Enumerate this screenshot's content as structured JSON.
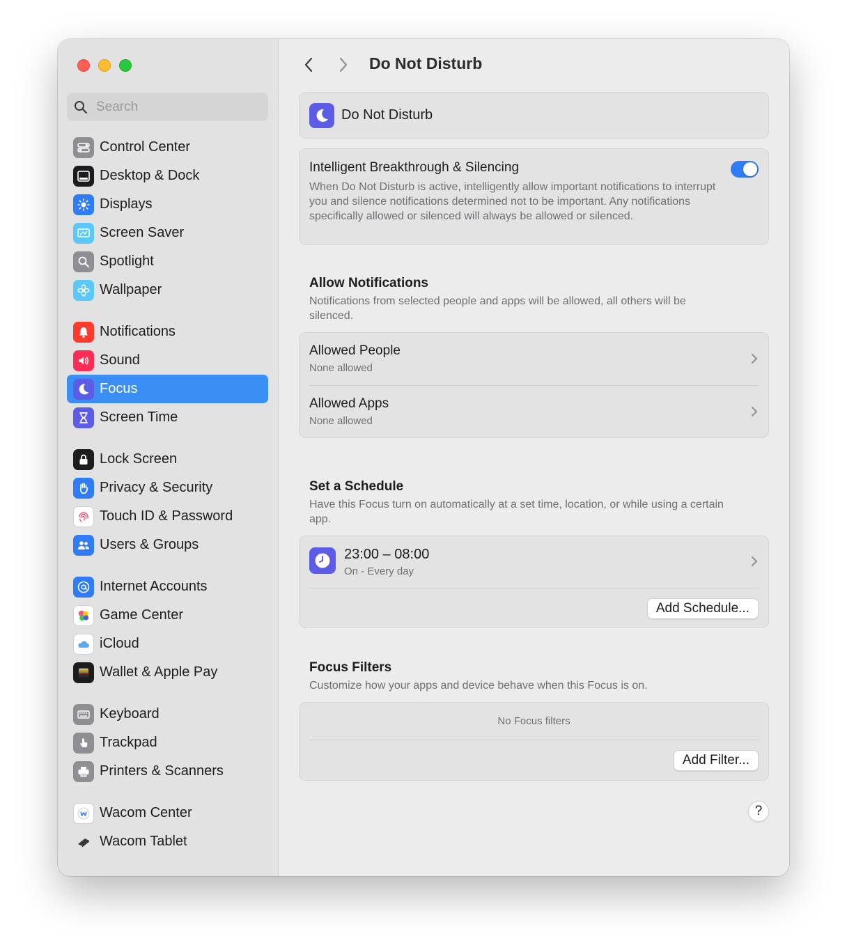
{
  "search": {
    "placeholder": "Search"
  },
  "sidebar": {
    "groups": [
      [
        {
          "label": "Control Center",
          "icon": "control-center-icon",
          "color": "#8e8e93"
        },
        {
          "label": "Desktop & Dock",
          "icon": "desktop-dock-icon",
          "color": "#1c1c1e"
        },
        {
          "label": "Displays",
          "icon": "displays-icon",
          "color": "#2f7cf6"
        },
        {
          "label": "Screen Saver",
          "icon": "screen-saver-icon",
          "color": "#5ac8fa"
        },
        {
          "label": "Spotlight",
          "icon": "spotlight-icon",
          "color": "#8e8e93"
        },
        {
          "label": "Wallpaper",
          "icon": "wallpaper-icon",
          "color": "#5ac8fa"
        }
      ],
      [
        {
          "label": "Notifications",
          "icon": "notifications-icon",
          "color": "#ff3b30"
        },
        {
          "label": "Sound",
          "icon": "sound-icon",
          "color": "#ff2d55"
        },
        {
          "label": "Focus",
          "icon": "focus-icon",
          "color": "#5d5ce6",
          "active": true
        },
        {
          "label": "Screen Time",
          "icon": "screen-time-icon",
          "color": "#5d5ce6"
        }
      ],
      [
        {
          "label": "Lock Screen",
          "icon": "lock-icon",
          "color": "#1c1c1e"
        },
        {
          "label": "Privacy & Security",
          "icon": "hand-icon",
          "color": "#2f7cf6"
        },
        {
          "label": "Touch ID & Password",
          "icon": "fingerprint-icon",
          "color": "#ffffff"
        },
        {
          "label": "Users & Groups",
          "icon": "users-icon",
          "color": "#2f7cf6"
        }
      ],
      [
        {
          "label": "Internet Accounts",
          "icon": "at-icon",
          "color": "#2f7cf6"
        },
        {
          "label": "Game Center",
          "icon": "game-center-icon",
          "color": "#ffffff"
        },
        {
          "label": "iCloud",
          "icon": "cloud-icon",
          "color": "#ffffff"
        },
        {
          "label": "Wallet & Apple Pay",
          "icon": "wallet-icon",
          "color": "#1c1c1e"
        }
      ],
      [
        {
          "label": "Keyboard",
          "icon": "keyboard-icon",
          "color": "#8e8e93"
        },
        {
          "label": "Trackpad",
          "icon": "trackpad-icon",
          "color": "#8e8e93"
        },
        {
          "label": "Printers & Scanners",
          "icon": "printer-icon",
          "color": "#8e8e93"
        }
      ],
      [
        {
          "label": "Wacom Center",
          "icon": "wacom-center-icon",
          "color": "#ffffff"
        },
        {
          "label": "Wacom Tablet",
          "icon": "wacom-tablet-icon",
          "color": "#ffffff"
        }
      ]
    ]
  },
  "header": {
    "title": "Do Not Disturb"
  },
  "dnd": {
    "label": "Do Not Disturb"
  },
  "breakthrough": {
    "title": "Intelligent Breakthrough & Silencing",
    "description": "When Do Not Disturb is active, intelligently allow important notifications to interrupt you and silence notifications determined not to be important. Any notifications specifically allowed or silenced will always be allowed or silenced.",
    "enabled": true
  },
  "allow": {
    "title": "Allow Notifications",
    "description": "Notifications from selected people and apps will be allowed, all others will be silenced.",
    "people": {
      "title": "Allowed People",
      "sub": "None allowed"
    },
    "apps": {
      "title": "Allowed Apps",
      "sub": "None allowed"
    }
  },
  "schedule": {
    "title": "Set a Schedule",
    "description": "Have this Focus turn on automatically at a set time, location, or while using a certain app.",
    "time": "23:00 – 08:00",
    "sub": "On - Every day",
    "add_label": "Add Schedule..."
  },
  "filters": {
    "title": "Focus Filters",
    "description": "Customize how your apps and device behave when this Focus is on.",
    "empty": "No Focus filters",
    "add_label": "Add Filter..."
  },
  "help": {
    "label": "?"
  },
  "colors": {
    "accent": "#3b8ef3",
    "focus_purple": "#5d5ce6",
    "toggle_on": "#2f7cf6"
  }
}
